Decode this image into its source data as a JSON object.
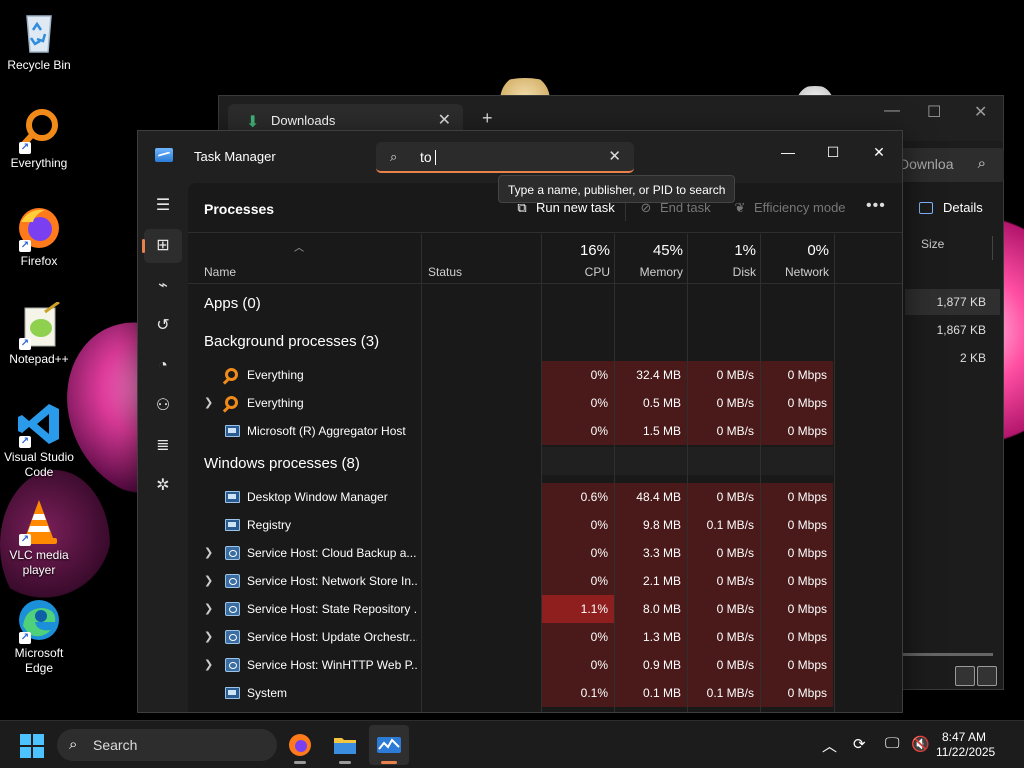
{
  "desktop": {
    "icons": [
      {
        "label": "Recycle Bin",
        "icon": "recycle-bin-icon"
      },
      {
        "label": "Everything",
        "icon": "everything-icon"
      },
      {
        "label": "Firefox",
        "icon": "firefox-icon"
      },
      {
        "label": "Notepad++",
        "icon": "notepadpp-icon"
      },
      {
        "label": "Visual Studio Code",
        "icon": "vscode-icon"
      },
      {
        "label": "VLC media player",
        "icon": "vlc-icon"
      },
      {
        "label": "Microsoft Edge",
        "icon": "edge-icon"
      }
    ]
  },
  "explorer": {
    "tab_label": "Downloads",
    "search_text": "Downloa",
    "details_label": "Details",
    "size_header": "Size",
    "file_sizes": [
      "1,877 KB",
      "1,867 KB",
      "2 KB"
    ]
  },
  "taskmgr": {
    "title": "Task Manager",
    "search": {
      "value": "to",
      "tooltip": "Type a name, publisher, or PID to search"
    },
    "window_controls": {
      "minimize": "—",
      "maximize": "☐",
      "close": "✕"
    },
    "page_title": "Processes",
    "toolbar": {
      "run_new_task": "Run new task",
      "end_task": "End task",
      "efficiency_mode": "Efficiency mode"
    },
    "columns": {
      "name": "Name",
      "status": "Status",
      "cpu": {
        "pct": "16%",
        "label": "CPU"
      },
      "memory": {
        "pct": "45%",
        "label": "Memory"
      },
      "disk": {
        "pct": "1%",
        "label": "Disk"
      },
      "network": {
        "pct": "0%",
        "label": "Network"
      }
    },
    "groups": {
      "apps": "Apps (0)",
      "background": "Background processes (3)",
      "windows": "Windows processes (8)"
    },
    "background_processes": [
      {
        "name": "Everything",
        "icon": "everything",
        "expandable": false,
        "cpu": "0%",
        "memory": "32.4 MB",
        "disk": "0 MB/s",
        "network": "0 Mbps",
        "cpu_hot": false
      },
      {
        "name": "Everything",
        "icon": "everything",
        "expandable": true,
        "cpu": "0%",
        "memory": "0.5 MB",
        "disk": "0 MB/s",
        "network": "0 Mbps",
        "cpu_hot": false
      },
      {
        "name": "Microsoft (R) Aggregator Host",
        "icon": "win",
        "expandable": false,
        "cpu": "0%",
        "memory": "1.5 MB",
        "disk": "0 MB/s",
        "network": "0 Mbps",
        "cpu_hot": false
      }
    ],
    "windows_processes": [
      {
        "name": "Desktop Window Manager",
        "icon": "win",
        "expandable": false,
        "cpu": "0.6%",
        "memory": "48.4 MB",
        "disk": "0 MB/s",
        "network": "0 Mbps",
        "cpu_hot": false
      },
      {
        "name": "Registry",
        "icon": "win",
        "expandable": false,
        "cpu": "0%",
        "memory": "9.8 MB",
        "disk": "0.1 MB/s",
        "network": "0 Mbps",
        "cpu_hot": false
      },
      {
        "name": "Service Host: Cloud Backup a...",
        "icon": "gear",
        "expandable": true,
        "cpu": "0%",
        "memory": "3.3 MB",
        "disk": "0 MB/s",
        "network": "0 Mbps",
        "cpu_hot": false
      },
      {
        "name": "Service Host: Network Store In...",
        "icon": "gear",
        "expandable": true,
        "cpu": "0%",
        "memory": "2.1 MB",
        "disk": "0 MB/s",
        "network": "0 Mbps",
        "cpu_hot": false
      },
      {
        "name": "Service Host: State Repository ...",
        "icon": "gear",
        "expandable": true,
        "cpu": "1.1%",
        "memory": "8.0 MB",
        "disk": "0 MB/s",
        "network": "0 Mbps",
        "cpu_hot": true
      },
      {
        "name": "Service Host: Update Orchestr...",
        "icon": "gear",
        "expandable": true,
        "cpu": "0%",
        "memory": "1.3 MB",
        "disk": "0 MB/s",
        "network": "0 Mbps",
        "cpu_hot": false
      },
      {
        "name": "Service Host: WinHTTP Web P...",
        "icon": "gear",
        "expandable": true,
        "cpu": "0%",
        "memory": "0.9 MB",
        "disk": "0 MB/s",
        "network": "0 Mbps",
        "cpu_hot": false
      },
      {
        "name": "System",
        "icon": "win",
        "expandable": false,
        "cpu": "0.1%",
        "memory": "0.1 MB",
        "disk": "0.1 MB/s",
        "network": "0 Mbps",
        "cpu_hot": false
      }
    ],
    "nav": [
      "hamburger-icon",
      "processes-icon",
      "performance-icon",
      "app-history-icon",
      "startup-apps-icon",
      "users-icon",
      "details-icon",
      "services-icon",
      "settings-icon"
    ]
  },
  "taskbar": {
    "search_label": "Search",
    "apps": [
      "firefox-icon",
      "file-explorer-icon",
      "task-manager-icon"
    ],
    "time": "8:47 AM",
    "date": "11/22/2025"
  },
  "colors": {
    "accent": "#e8814a",
    "heat_low": "#4a1a1a",
    "heat_high": "#8f1f1f"
  }
}
